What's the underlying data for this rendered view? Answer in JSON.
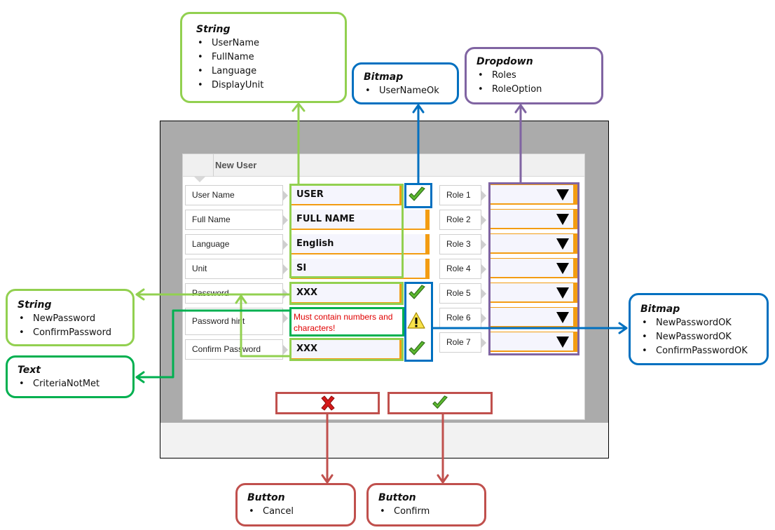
{
  "dialog": {
    "title": "New User",
    "fields": [
      {
        "label": "User Name",
        "value": "USER"
      },
      {
        "label": "Full Name",
        "value": "FULL NAME"
      },
      {
        "label": "Language",
        "value": "English"
      },
      {
        "label": "Unit",
        "value": "SI"
      },
      {
        "label": "Password",
        "value": "XXX"
      },
      {
        "label": "Password hint",
        "value": "Must contain numbers and characters!"
      },
      {
        "label": "Confirm Password",
        "value": "XXX"
      }
    ],
    "status_icons": {
      "user_name": "check-icon",
      "password": "check-icon",
      "password_hint": "warning-icon",
      "confirm_password": "check-icon"
    },
    "roles": [
      {
        "label": "Role 1",
        "value": ""
      },
      {
        "label": "Role 2",
        "value": ""
      },
      {
        "label": "Role 3",
        "value": ""
      },
      {
        "label": "Role 4",
        "value": ""
      },
      {
        "label": "Role 5",
        "value": ""
      },
      {
        "label": "Role 6",
        "value": ""
      },
      {
        "label": "Role 7",
        "value": ""
      }
    ],
    "buttons": {
      "cancel_icon": "cross-icon",
      "confirm_icon": "check-icon"
    }
  },
  "callouts": {
    "string_top": {
      "title": "String",
      "items": [
        "UserName",
        "FullName",
        "Language",
        "DisplayUnit"
      ]
    },
    "bitmap_top": {
      "title": "Bitmap",
      "items": [
        "UserNameOk"
      ]
    },
    "dropdown": {
      "title": "Dropdown",
      "items": [
        "Roles",
        "RoleOption"
      ]
    },
    "string_left": {
      "title": "String",
      "items": [
        "NewPassword",
        "ConfirmPassword"
      ]
    },
    "text_left": {
      "title": "Text",
      "items": [
        "CriteriaNotMet"
      ]
    },
    "bitmap_right": {
      "title": "Bitmap",
      "items": [
        "NewPasswordOK",
        "NewPasswordOK",
        "ConfirmPasswordOK"
      ]
    },
    "button_cancel": {
      "title": "Button",
      "items": [
        "Cancel"
      ]
    },
    "button_confirm": {
      "title": "Button",
      "items": [
        "Confirm"
      ]
    }
  },
  "colors": {
    "string": "#92d050",
    "bitmap": "#0070c0",
    "dropdown": "#8064a2",
    "text": "#00b050",
    "button": "#c0504d",
    "accent_orange": "#f39c12",
    "hint_red": "#e00000"
  }
}
